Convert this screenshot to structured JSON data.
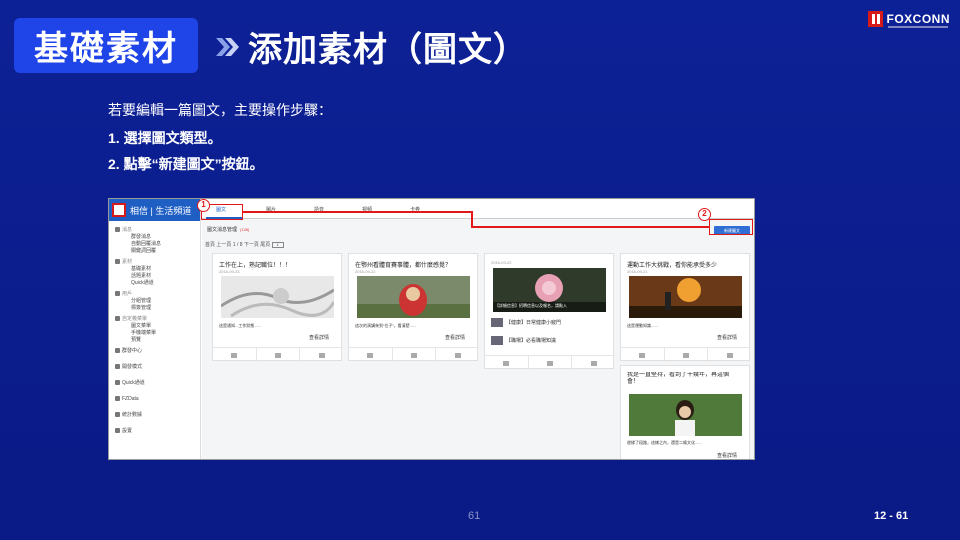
{
  "header": {
    "tag": "基礎素材",
    "title": "添加素材（圖文）",
    "logo_text": "FOXCONN"
  },
  "body": {
    "intro": "若要編輯一篇圖文，主要操作步驟：",
    "steps": [
      "1. 選擇圖文類型。",
      "2. 點擊“新建圖文”按鈕。"
    ]
  },
  "screenshot": {
    "app_title": "相信 | 生活頻道",
    "tabs": [
      "圖文",
      "圖片",
      "語音",
      "視頻",
      "卡券"
    ],
    "section_title": "圖文消息管理",
    "section_hint": "(128)",
    "new_button": "新建圖文",
    "pager": "首頁 上一頁 1 / 8 下一頁 尾頁",
    "pager_select": "1",
    "sidebar": [
      {
        "label": "消息",
        "type": "grp"
      },
      {
        "label": "群發消息",
        "type": "sub"
      },
      {
        "label": "自動回覆消息",
        "type": "sub"
      },
      {
        "label": "關鍵詞回覆",
        "type": "sub"
      },
      {
        "label": "素材",
        "type": "grp"
      },
      {
        "label": "基礎素材",
        "type": "sub"
      },
      {
        "label": "話題素材",
        "type": "sub"
      },
      {
        "label": "Quick通道",
        "type": "sub"
      },
      {
        "label": "用戶",
        "type": "grp"
      },
      {
        "label": "分組管理",
        "type": "sub"
      },
      {
        "label": "標簽管理",
        "type": "sub"
      },
      {
        "label": "自定義菜單",
        "type": "grp"
      },
      {
        "label": "圖文菜單",
        "type": "sub"
      },
      {
        "label": "手機端菜單",
        "type": "sub"
      },
      {
        "label": "預覽",
        "type": "sub"
      },
      {
        "label": "群發中心",
        "type": "top"
      },
      {
        "label": "開發模式",
        "type": "top"
      },
      {
        "label": "Quick通道",
        "type": "top"
      },
      {
        "label": "FZData",
        "type": "top"
      },
      {
        "label": "統計數據",
        "type": "top"
      },
      {
        "label": "設置",
        "type": "top"
      }
    ],
    "cards": [
      {
        "title": "工作在上，熟記職位！！！",
        "date": "2016-09-23",
        "desc": "這是通知...工作狀態......",
        "more": "查看詳情"
      },
      {
        "title": "在鄂州看體育賽事體，都什麼感覺？",
        "date": "2016-09-22",
        "desc": "這次的演講來到“位子”，看清楚......",
        "more": "查看詳情"
      },
      {
        "title": "",
        "date": "2016-09-22",
        "overlay": "【詳細信息】招聘信息以及報名，請點入",
        "news": [
          "【健康】日常健康小竅門",
          "【職場】必看職場知識"
        ]
      },
      {
        "title": "運動工作大挑戰，看你能承受多少",
        "date": "2016-09-21",
        "desc": "這是運動知識......",
        "more": "查看詳情"
      },
      {
        "title": "我是一直堅持，看到了十幾年，再這個會！",
        "date": "",
        "desc": "邊緣了段路，這樣之內，還是二條文化......",
        "more": "查看詳情"
      }
    ]
  },
  "footer": {
    "page": "61",
    "slide": "12 - 61"
  }
}
